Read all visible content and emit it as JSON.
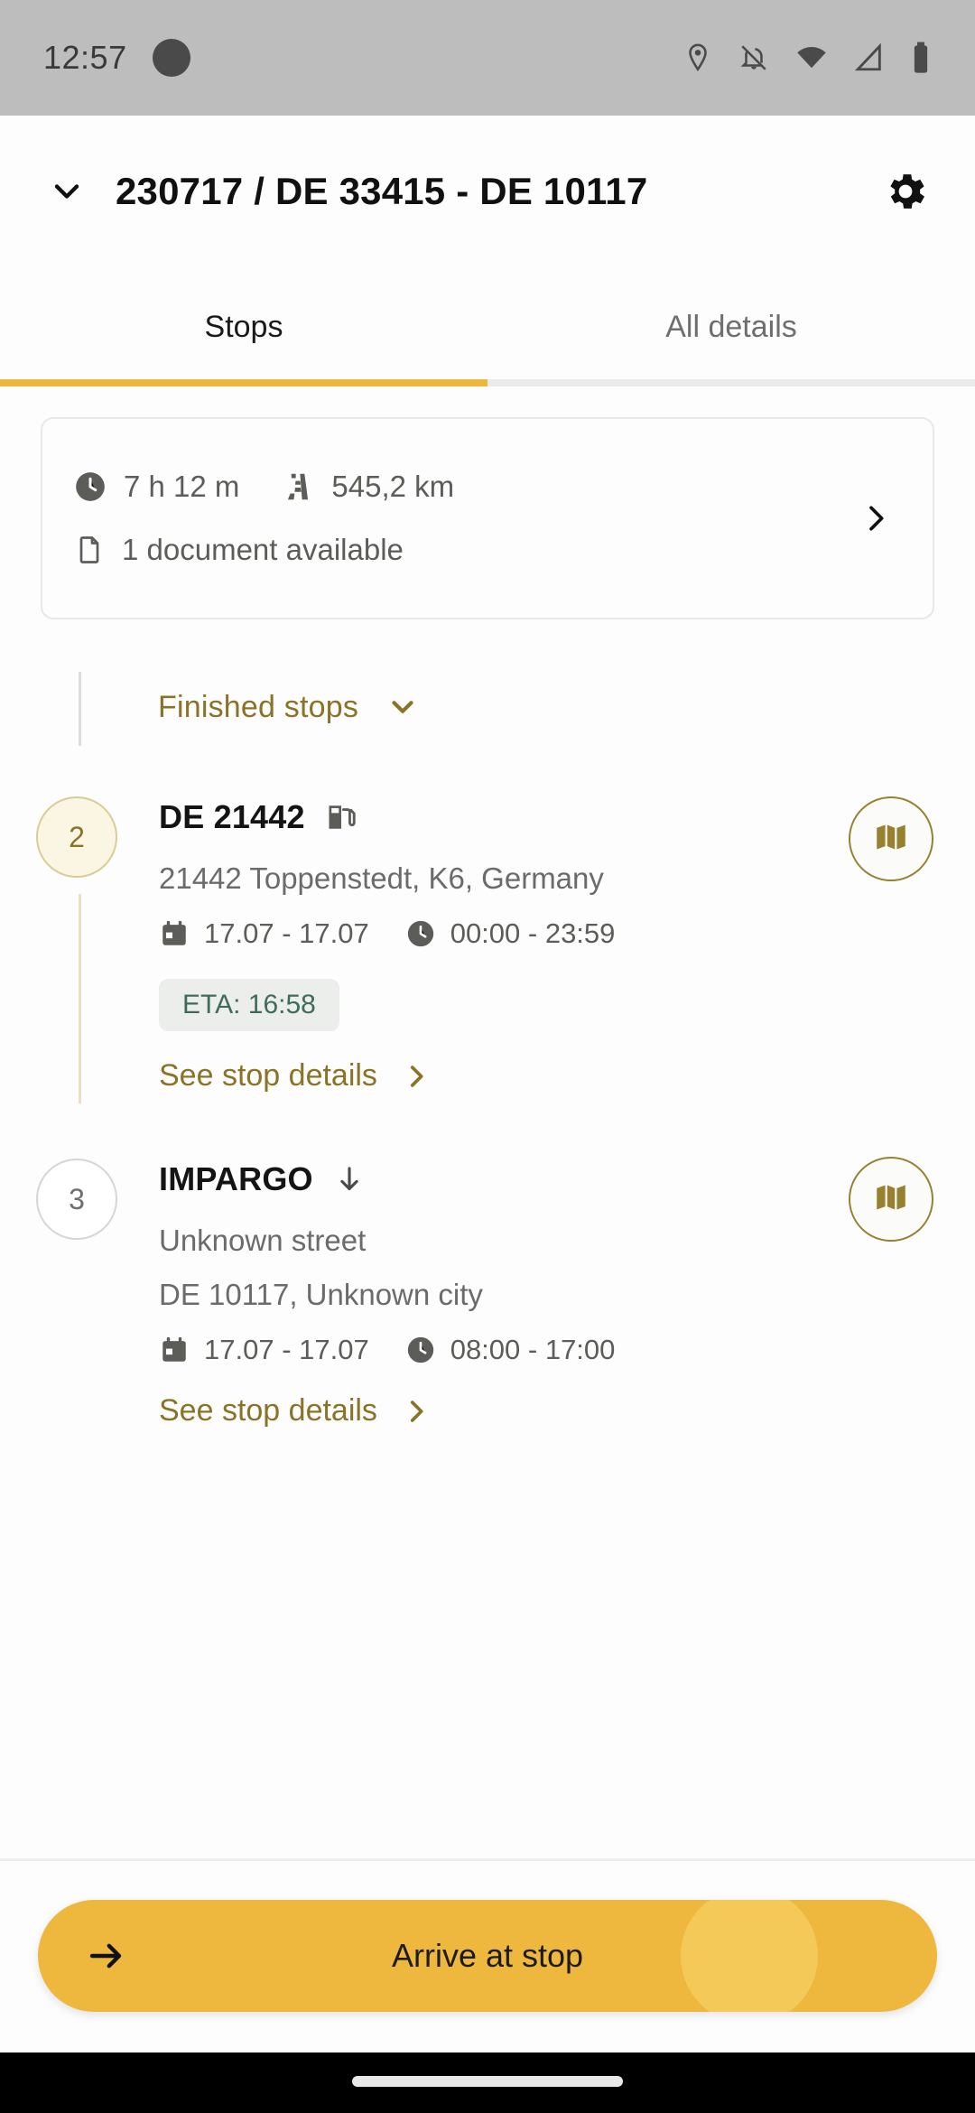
{
  "status_bar": {
    "time": "12:57",
    "icons": [
      "notification-dot",
      "location-pin-icon",
      "notifications-off-icon",
      "wifi-icon",
      "cellular-signal-icon",
      "battery-icon"
    ]
  },
  "app_bar": {
    "title": "230717 / DE 33415 - DE 10117",
    "left_icon": "chevron-down-icon",
    "right_icon": "gear-icon"
  },
  "tabs": [
    {
      "label": "Stops",
      "active": true
    },
    {
      "label": "All details",
      "active": false
    }
  ],
  "summary": {
    "duration": "7 h 12 m",
    "distance": "545,2 km",
    "documents": "1 document available",
    "chevron": "chevron-right-icon"
  },
  "finished_section": {
    "label": "Finished stops",
    "chevron": "chevron-down-icon"
  },
  "stops": [
    {
      "number": "2",
      "state": "done",
      "title": "DE 21442",
      "type_icon": "fuel-pump-icon",
      "address": "21442 Toppenstedt, K6, Germany",
      "date_range": "17.07 - 17.07",
      "time_range": "00:00 - 23:59",
      "eta": "ETA: 16:58",
      "details_link": "See stop details",
      "map_icon": "map-icon"
    },
    {
      "number": "3",
      "state": "pending",
      "title": "IMPARGO",
      "type_icon": "arrow-down-unload-icon",
      "address_line1": "Unknown street",
      "address_line2": "DE 10117, Unknown city",
      "date_range": "17.07 - 17.07",
      "time_range": "08:00 - 17:00",
      "details_link": "See stop details",
      "map_icon": "map-icon"
    }
  ],
  "bottom_action": {
    "label": "Arrive at stop",
    "icon": "arrow-right-icon"
  },
  "colors": {
    "accent_gold": "#edb73e",
    "accent_gold_dark": "#8a7326",
    "button_bg": "#eeb83f",
    "eta_text": "#3f6b5b",
    "eta_bg": "#eceeec",
    "status_bar_bg": "#bdbdbd"
  }
}
